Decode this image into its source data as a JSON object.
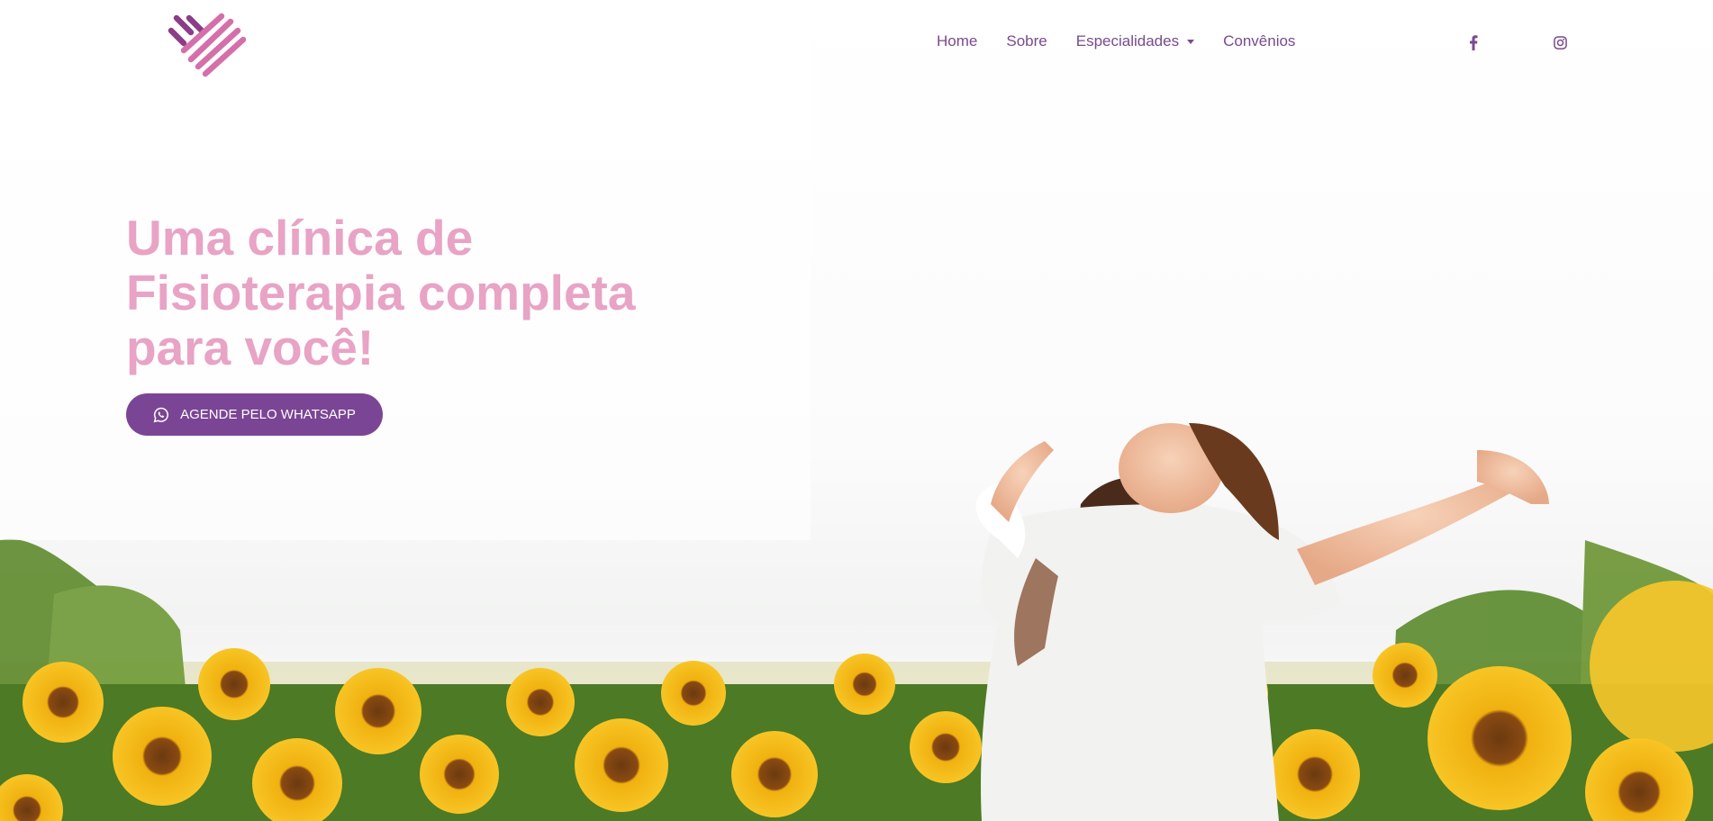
{
  "header": {
    "logo_icon": "heart-stripes-logo",
    "nav": [
      {
        "label": "Home"
      },
      {
        "label": "Sobre"
      },
      {
        "label": "Especialidades",
        "has_dropdown": true
      },
      {
        "label": "Convênios"
      }
    ],
    "social": [
      {
        "icon": "facebook-icon"
      },
      {
        "icon": "instagram-icon"
      }
    ]
  },
  "hero": {
    "title_lines": [
      "Uma clínica de",
      "Fisioterapia completa",
      "para você!"
    ],
    "cta_label": "AGENDE PELO WHATSAPP",
    "cta_icon": "whatsapp-icon",
    "image_description_icon": "hero-background-image"
  },
  "colors": {
    "brand_purple": "#7b4595",
    "title_pink": "#e8a3c5",
    "nav_text": "#7a4a8e",
    "logo_pink": "#d46fa9"
  }
}
